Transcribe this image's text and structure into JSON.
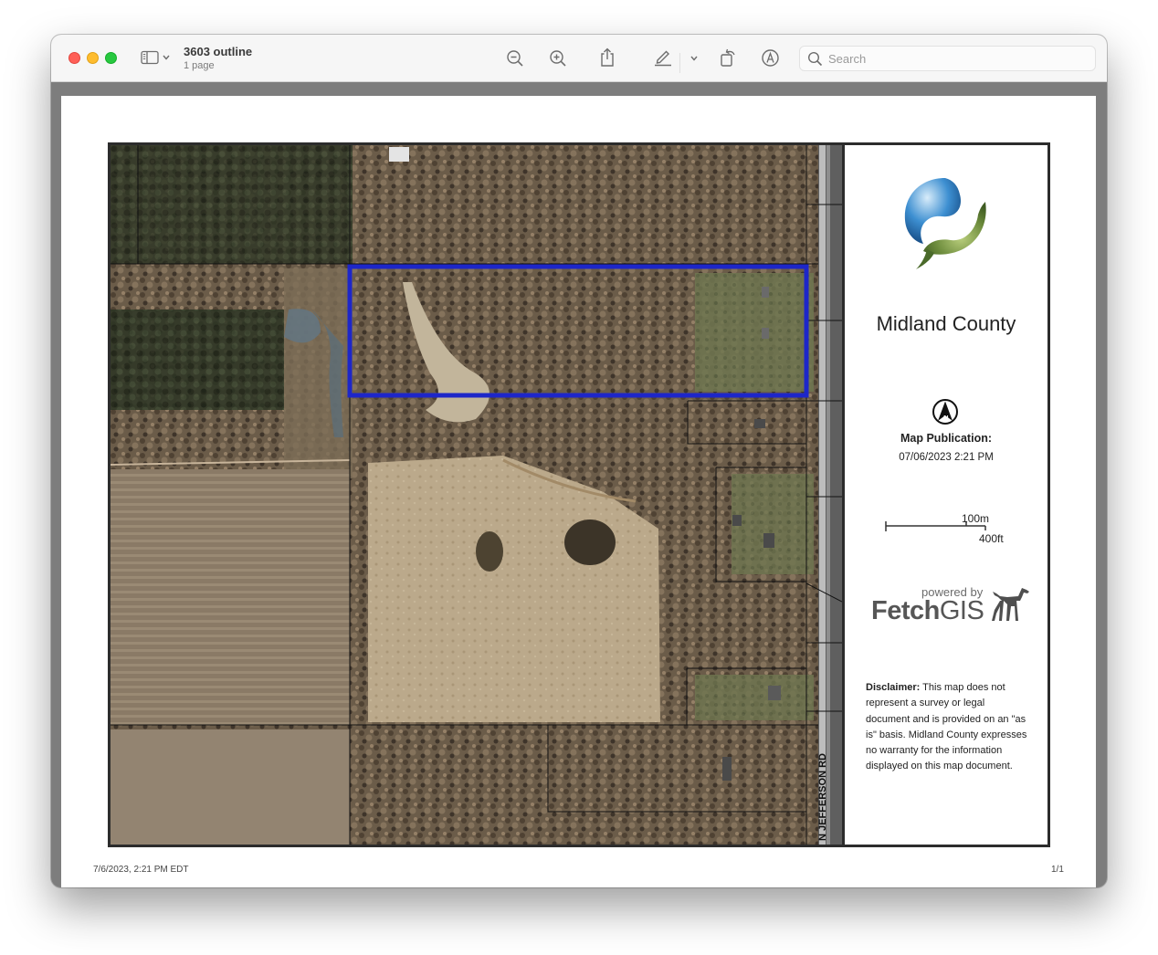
{
  "window": {
    "title": "3603 outline",
    "subtitle": "1 page",
    "search_placeholder": "Search"
  },
  "toolbar": {
    "icons": [
      "sidebar-icon",
      "chevron-down-icon",
      "zoom-out-icon",
      "zoom-in-icon",
      "share-icon",
      "markup-pen-icon",
      "chevron-down-icon",
      "rotate-icon",
      "annotate-icon",
      "search-icon"
    ]
  },
  "map": {
    "county": "Midland County",
    "publication_label": "Map Publication:",
    "publication_date": "07/06/2023 2:21 PM",
    "scale_metric": "100m",
    "scale_imperial": "400ft",
    "road_label": "N JEFFERSON RD",
    "powered_by": "powered by",
    "brand_fetch": "Fetch",
    "brand_gis": "GIS",
    "disclaimer_label": "Disclaimer:",
    "disclaimer_text": " This map does not represent a survey or legal document and is provided on an \"as is\" basis. Midland County expresses no warranty for the information displayed on this map document.",
    "outline_color": "#1d26c9"
  },
  "footer": {
    "timestamp": "7/6/2023, 2:21 PM EDT",
    "page_count": "1/1"
  }
}
